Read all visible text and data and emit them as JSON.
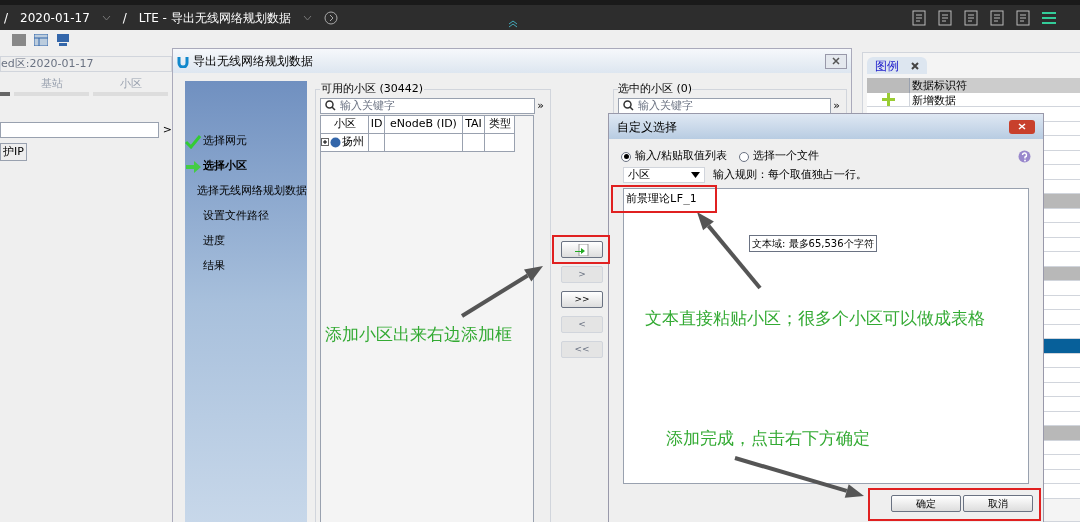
{
  "topbar": {
    "separator": "/",
    "breadcrumbs": [
      "2020-01-17",
      "LTE - 导出无线网络规划数据"
    ]
  },
  "left_panel": {
    "combo": "ed区:2020-01-17",
    "tabs": [
      {
        "selected": true
      },
      {
        "label": "基站",
        "selected": false
      },
      {
        "label": "小区",
        "selected": false
      }
    ],
    "more": ">",
    "button": "护IP"
  },
  "export_dialog": {
    "title": "导出无线网络规划数据",
    "steps": [
      {
        "label": "选择网元",
        "kind": "done"
      },
      {
        "label": "选择小区",
        "kind": "current"
      },
      {
        "label": "选择无线网络规划数据",
        "kind": "pending"
      },
      {
        "label": "设置文件路径",
        "kind": "pending"
      },
      {
        "label": "进度",
        "kind": "pending"
      },
      {
        "label": "结果",
        "kind": "pending"
      }
    ],
    "available": {
      "title": "可用的小区 (30442)",
      "placeholder": "输入关键字",
      "more": "»",
      "columns": [
        "小区",
        "ID",
        "eNodeB (ID)",
        "TAI",
        "类型"
      ],
      "rows": [
        {
          "name": "扬州",
          "expanded": false
        }
      ]
    },
    "move_buttons": [
      {
        "kind": "icon",
        "disabled": false
      },
      {
        "kind": "text",
        "label": ">",
        "disabled": true
      },
      {
        "kind": "text",
        "label": ">>",
        "disabled": false
      },
      {
        "kind": "text",
        "label": "<",
        "disabled": true
      },
      {
        "kind": "text",
        "label": "<<",
        "disabled": true
      }
    ],
    "selected": {
      "title": "选中的小区 (0)",
      "placeholder": "输入关键字",
      "more": "»"
    }
  },
  "legend": {
    "tab": "图例",
    "columns": [
      "数据标识符"
    ],
    "rows": [
      {
        "kind": "add",
        "label": "新增数据"
      }
    ],
    "empty_rows": [
      {
        "kind": "plain"
      },
      {
        "kind": "plain"
      },
      {
        "kind": "plain"
      },
      {
        "kind": "plain"
      },
      {
        "kind": "plain"
      },
      {
        "kind": "plain"
      },
      {
        "kind": "group"
      },
      {
        "kind": "plain"
      },
      {
        "kind": "plain"
      },
      {
        "kind": "plain"
      },
      {
        "kind": "plain"
      },
      {
        "kind": "group"
      },
      {
        "kind": "plain"
      },
      {
        "kind": "plain"
      },
      {
        "kind": "plain"
      },
      {
        "kind": "plain"
      },
      {
        "kind": "selected"
      },
      {
        "kind": "plain"
      },
      {
        "kind": "plain"
      },
      {
        "kind": "plain"
      },
      {
        "kind": "plain"
      },
      {
        "kind": "plain"
      },
      {
        "kind": "group"
      },
      {
        "kind": "plain"
      },
      {
        "kind": "plain"
      },
      {
        "kind": "plain"
      },
      {
        "kind": "plain"
      }
    ]
  },
  "custom_dialog": {
    "title": "自定义选择",
    "options": [
      {
        "label": "输入/粘贴取值列表",
        "selected": true
      },
      {
        "label": "选择一个文件",
        "selected": false
      }
    ],
    "combo": "小区",
    "rule": "输入规则：每个取值独占一行。",
    "value": "前景理论LF_1",
    "tooltip": "文本域: 最多65,536个字符",
    "buttons": [
      "确定",
      "取消"
    ]
  },
  "annotations": [
    {
      "text": "添加小区出来右边添加框"
    },
    {
      "text": "文本直接粘贴小区；很多个小区可以做成表格"
    },
    {
      "text": "添加完成，点击右下方确定"
    }
  ]
}
